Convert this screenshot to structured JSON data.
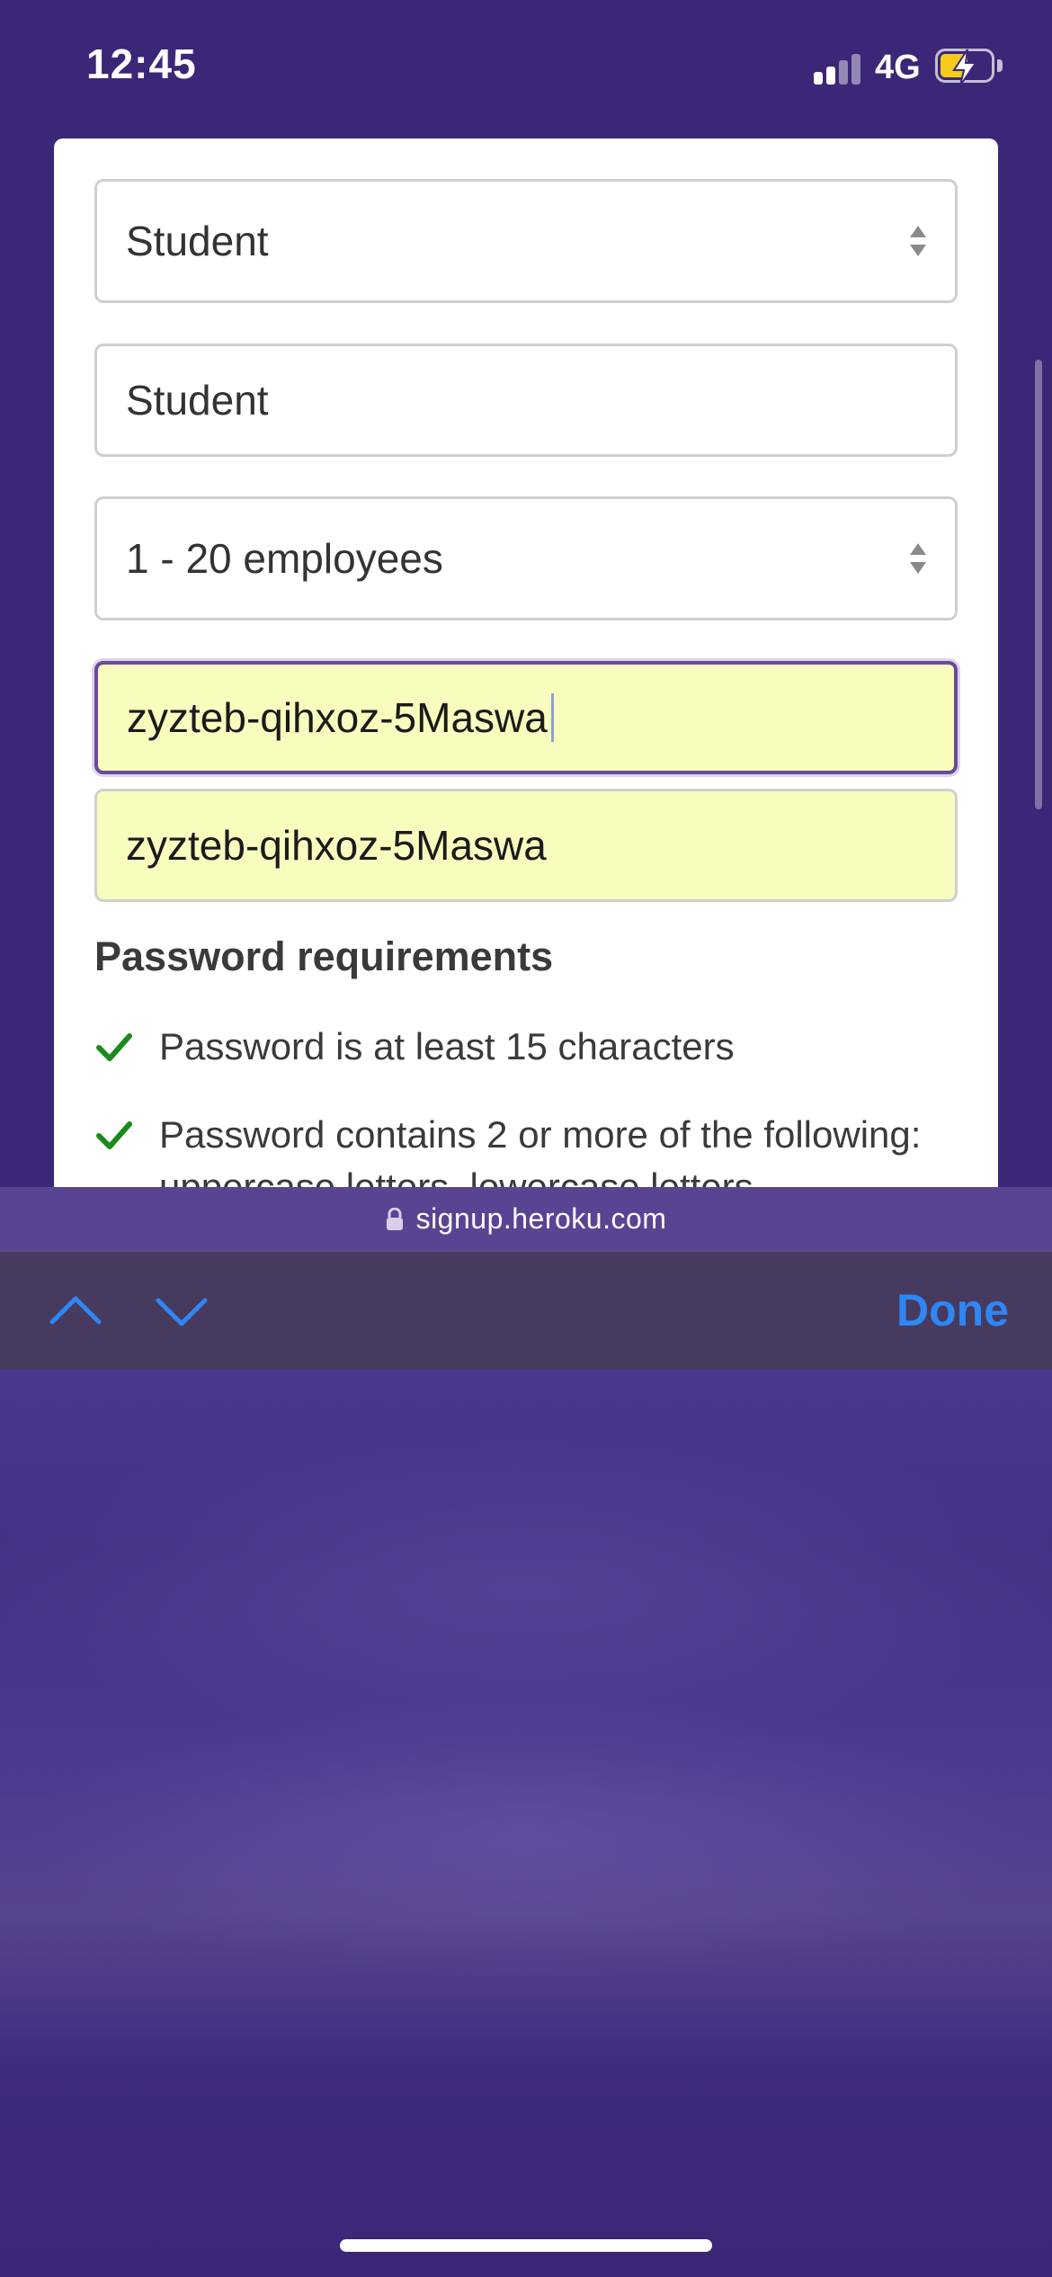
{
  "status_bar": {
    "time": "12:45",
    "network": "4G",
    "battery_icon": "battery-charging-icon",
    "battery_color": "#f5cc1b"
  },
  "form": {
    "role_select": {
      "value": "Student"
    },
    "company_field": {
      "value": "Student"
    },
    "size_select": {
      "value": "1 - 20 employees"
    },
    "password_field": {
      "value": "zyzteb-qihxoz-5Maswa"
    },
    "confirm_password_field": {
      "value": "zyzteb-qihxoz-5Maswa"
    },
    "autofill_color": "#f8fcbd"
  },
  "requirements": {
    "title": "Password requirements",
    "check_color": "#1a8a1a",
    "items": [
      {
        "text": "Password is at least 15 characters"
      },
      {
        "text": "Password contains 2 or more of the following:"
      }
    ],
    "partial_cutoff_text": "uppercase letters, lowercase letters"
  },
  "url_bar": {
    "url": "signup.heroku.com"
  },
  "accessory_bar": {
    "done_label": "Done",
    "accent_color": "#2f86f5"
  },
  "theme": {
    "background": "#3b2677"
  }
}
